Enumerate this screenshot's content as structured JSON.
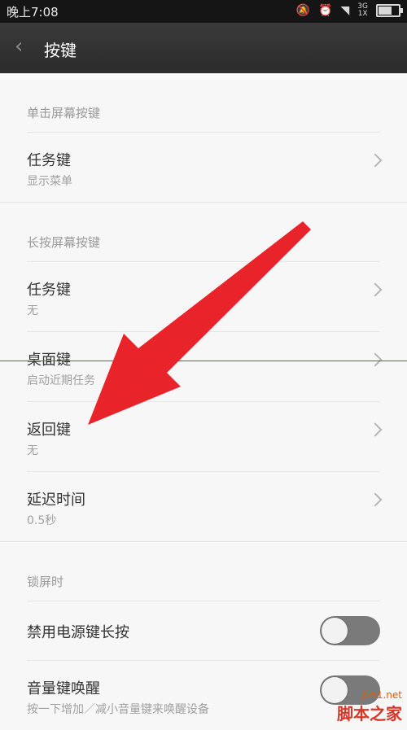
{
  "statusbar": {
    "time": "晚上7:08",
    "net_type": "3G",
    "net_sub": "1X"
  },
  "titlebar": {
    "back_icon": "chevron-left-icon",
    "title": "按键"
  },
  "sections": [
    {
      "header": "单击屏幕按键",
      "items": [
        {
          "title": "任务键",
          "subtitle": "显示菜单",
          "control": "chevron"
        }
      ]
    },
    {
      "header": "长按屏幕按键",
      "items": [
        {
          "title": "任务键",
          "subtitle": "无",
          "control": "chevron"
        },
        {
          "title": "桌面键",
          "subtitle": "启动近期任务",
          "control": "chevron"
        },
        {
          "title": "返回键",
          "subtitle": "无",
          "control": "chevron"
        },
        {
          "title": "延迟时间",
          "subtitle": "0.5秒",
          "control": "chevron"
        }
      ]
    },
    {
      "header": "锁屏时",
      "items": [
        {
          "title": "禁用电源键长按",
          "subtitle": "",
          "control": "toggle",
          "enabled": false
        },
        {
          "title": "音量键唤醒",
          "subtitle": "按一下增加／减小音量键来唤醒设备",
          "control": "toggle",
          "enabled": false
        }
      ]
    }
  ],
  "watermark": {
    "domain": "jb51.net",
    "brand": "脚本之家"
  },
  "colors": {
    "arrow": "#e8232a",
    "guide_line": "#c0392b"
  }
}
